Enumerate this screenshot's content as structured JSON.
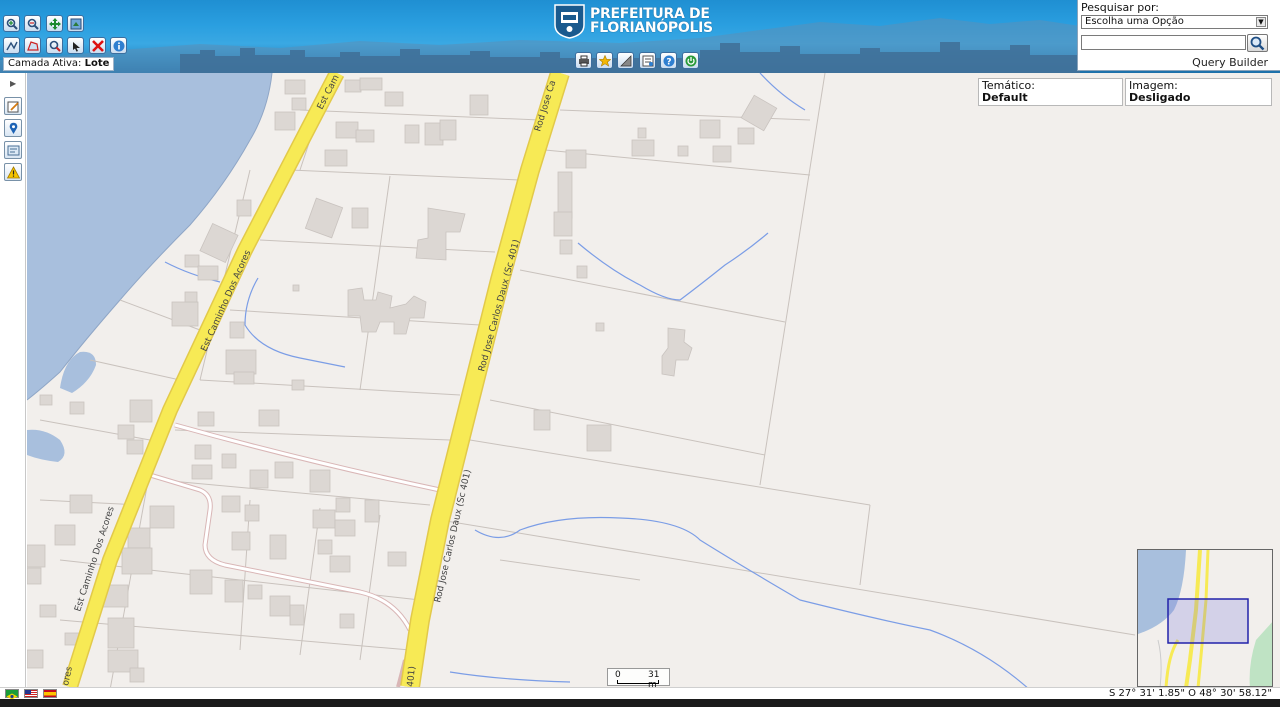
{
  "header": {
    "logo_line1": "PREFEITURA DE",
    "logo_line2": "FLORIANÓPOLIS",
    "active_layer_label": "Camada Ativa:",
    "active_layer_value": "Lote",
    "toolbar_top": [
      "zoom-in-icon",
      "zoom-out-icon",
      "pan-icon",
      "full-extent-icon"
    ],
    "toolbar_bottom": [
      "measure-distance-icon",
      "measure-area-icon",
      "zoom-box-icon",
      "select-icon",
      "clear-icon",
      "info-icon"
    ],
    "map_tools": [
      "print-icon",
      "favorite-icon",
      "measure-icon",
      "export-icon",
      "help-icon",
      "logout-icon"
    ]
  },
  "search": {
    "label": "Pesquisar por:",
    "selected_option": "Escolha uma Opção",
    "input_value": "",
    "query_builder_label": "Query Builder"
  },
  "panels": {
    "thematic_label": "Temático:",
    "thematic_value": "Default",
    "image_label": "Imagem:",
    "image_value": "Desligado"
  },
  "map": {
    "road_labels": {
      "caminho_acores_1": "Est Caminho Dos Acores",
      "caminho_acores_2": "Est Caminho Dos Acores",
      "caminho_acores_top": "Est Cam",
      "caminho_acores_bottom": "ores",
      "carlos_daux_1": "Rod Jose Carlos Daux (Sc 401)",
      "carlos_daux_2": "Rod Jose Carlos Daux (Sc 401)",
      "carlos_daux_top": "Rod Jose Ca",
      "carlos_daux_bottom": "401)"
    },
    "scale": {
      "start": "0",
      "end": "31 m"
    },
    "colors": {
      "land": "#f2efec",
      "water": "#a8bfdd",
      "road": "#f7ea55",
      "road_edge": "#e2c94a",
      "building": "#dcd7d3",
      "stream": "#7b9de6",
      "parcel": "#c9c2bd"
    }
  },
  "sidebar": {
    "tools": [
      "edit-icon",
      "marker-icon",
      "notes-icon",
      "warning-icon"
    ]
  },
  "status": {
    "languages": [
      "brazil-flag-icon",
      "usa-flag-icon",
      "spain-flag-icon"
    ],
    "coordinates": "S 27° 31' 1.85\" O 48° 30' 58.12\""
  }
}
